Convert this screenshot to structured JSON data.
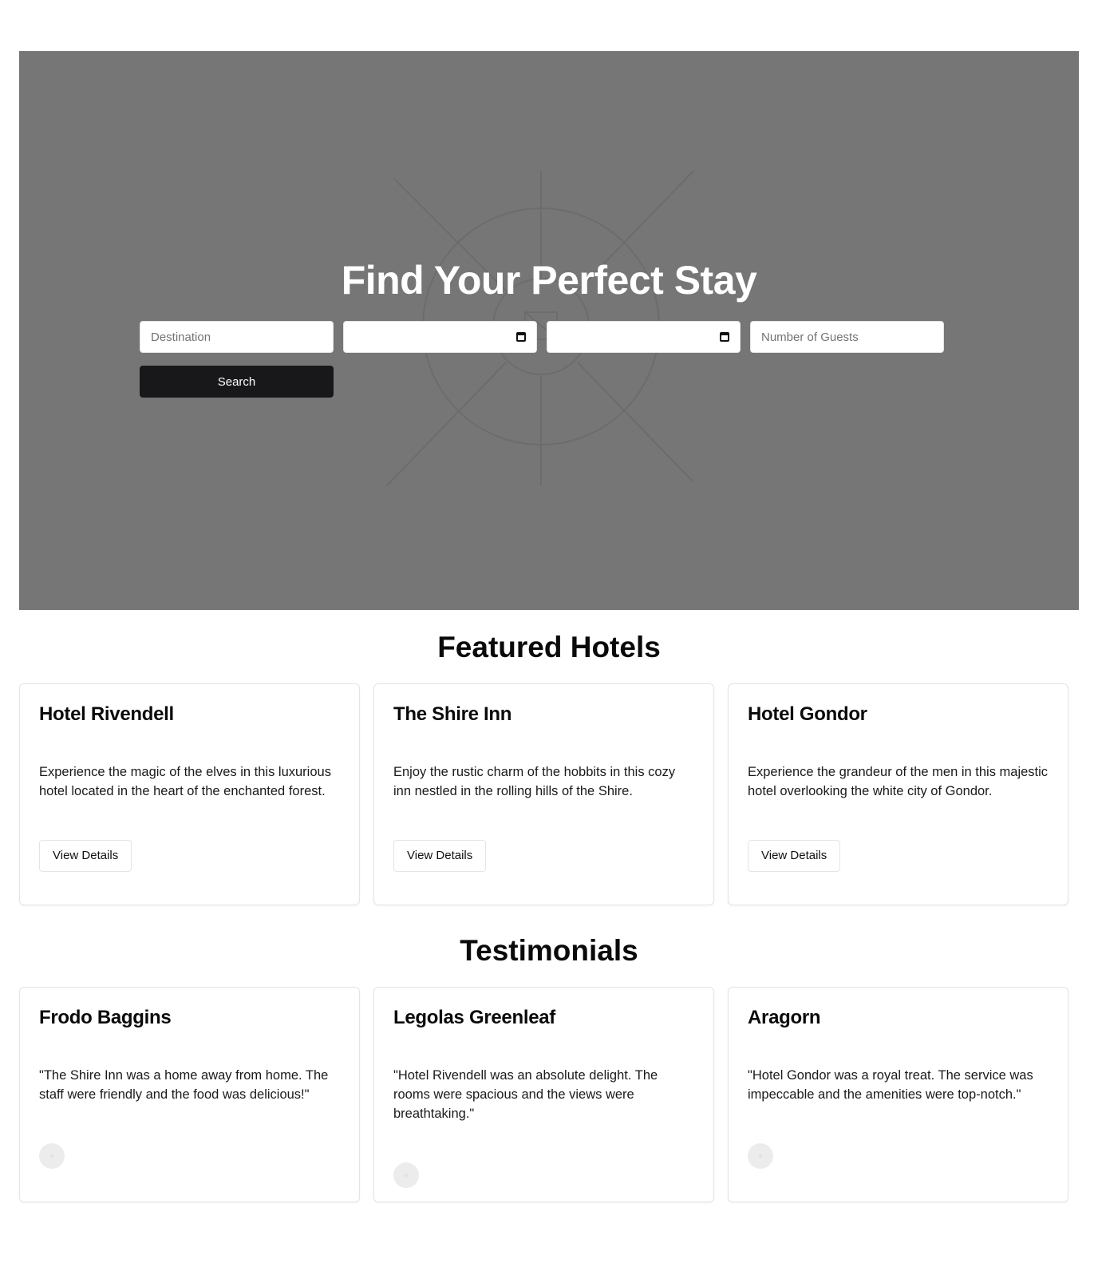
{
  "hero": {
    "title": "Find Your Perfect Stay",
    "destination_placeholder": "Destination",
    "guests_placeholder": "Number of Guests",
    "search_label": "Search"
  },
  "featured": {
    "title": "Featured Hotels",
    "hotels": [
      {
        "name": "Hotel Rivendell",
        "description": "Experience the magic of the elves in this luxurious hotel located in the heart of the enchanted forest.",
        "button": "View Details"
      },
      {
        "name": "The Shire Inn",
        "description": "Enjoy the rustic charm of the hobbits in this cozy inn nestled in the rolling hills of the Shire.",
        "button": "View Details"
      },
      {
        "name": "Hotel Gondor",
        "description": "Experience the grandeur of the men in this majestic hotel overlooking the white city of Gondor.",
        "button": "View Details"
      }
    ]
  },
  "testimonials": {
    "title": "Testimonials",
    "items": [
      {
        "name": "Frodo Baggins",
        "quote": "\"The Shire Inn was a home away from home. The staff were friendly and the food was delicious!\""
      },
      {
        "name": "Legolas Greenleaf",
        "quote": "\"Hotel Rivendell was an absolute delight. The rooms were spacious and the views were breathtaking.\""
      },
      {
        "name": "Aragorn",
        "quote": "\"Hotel Gondor was a royal treat. The service was impeccable and the amenities were top-notch.\""
      }
    ]
  },
  "colors": {
    "hero_background": "#767676",
    "button_dark": "#18181b",
    "card_border": "#e4e4e7"
  }
}
